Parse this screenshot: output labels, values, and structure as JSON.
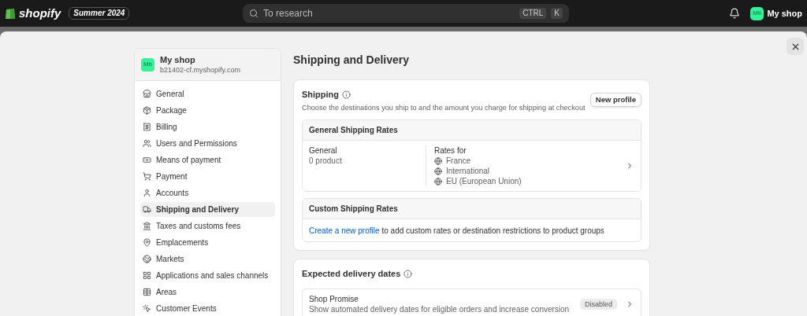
{
  "topbar": {
    "logo": "shopify",
    "edition": "Summer 2024",
    "search": {
      "placeholder": "To research"
    },
    "shortcut": [
      "CTRL",
      "K"
    ],
    "avatar": "Mb",
    "shop": "My shop"
  },
  "sidebar": {
    "avatar": "Mb",
    "shop_name": "My shop",
    "shop_domain": "b21402-cf.myshopify.com",
    "items": [
      {
        "label": "General",
        "selected": false
      },
      {
        "label": "Package",
        "selected": false
      },
      {
        "label": "Billing",
        "selected": false
      },
      {
        "label": "Users and Permissions",
        "selected": false
      },
      {
        "label": "Means of payment",
        "selected": false
      },
      {
        "label": "Payment",
        "selected": false
      },
      {
        "label": "Accounts",
        "selected": false
      },
      {
        "label": "Shipping and Delivery",
        "selected": true
      },
      {
        "label": "Taxes and customs fees",
        "selected": false
      },
      {
        "label": "Emplacements",
        "selected": false
      },
      {
        "label": "Markets",
        "selected": false
      },
      {
        "label": "Applications and sales channels",
        "selected": false
      },
      {
        "label": "Areas",
        "selected": false
      },
      {
        "label": "Customer Events",
        "selected": false
      }
    ]
  },
  "page_title": "Shipping and Delivery",
  "shipping": {
    "title": "Shipping",
    "description": "Choose the destinations you ship to and the amount you charge for shipping at checkout",
    "button": "New profile",
    "general_rates": {
      "title": "General Shipping Rates",
      "profile": "General",
      "products": "0 product",
      "rates_label": "Rates for",
      "zones": [
        "France",
        "International",
        "EU (European Union)"
      ]
    },
    "custom_rates": {
      "title": "Custom Shipping Rates",
      "link": "Create a new profile",
      "text": "to add custom rates or destination restrictions to product groups"
    }
  },
  "delivery_dates": {
    "title": "Expected delivery dates",
    "item": {
      "title": "Shop Promise",
      "description": "Show automated delivery dates for eligible orders and increase conversion",
      "status": "Disabled"
    }
  }
}
